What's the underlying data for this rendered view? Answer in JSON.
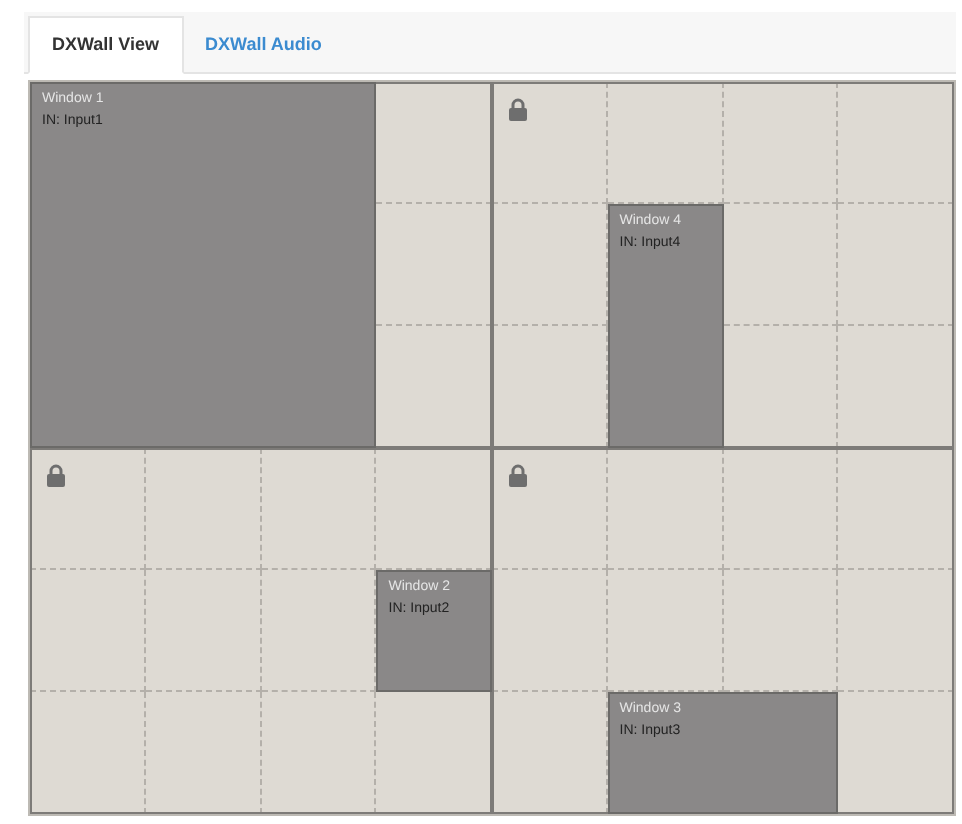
{
  "tabs": [
    {
      "label": "DXWall View",
      "selected": true
    },
    {
      "label": "DXWall Audio",
      "selected": false
    }
  ],
  "wall": {
    "windows": [
      {
        "title": "Window 1",
        "input": "IN: Input1"
      },
      {
        "title": "Window 4",
        "input": "IN: Input4"
      },
      {
        "title": "Window 2",
        "input": "IN: Input2"
      },
      {
        "title": "Window 3",
        "input": "IN: Input3"
      }
    ]
  }
}
